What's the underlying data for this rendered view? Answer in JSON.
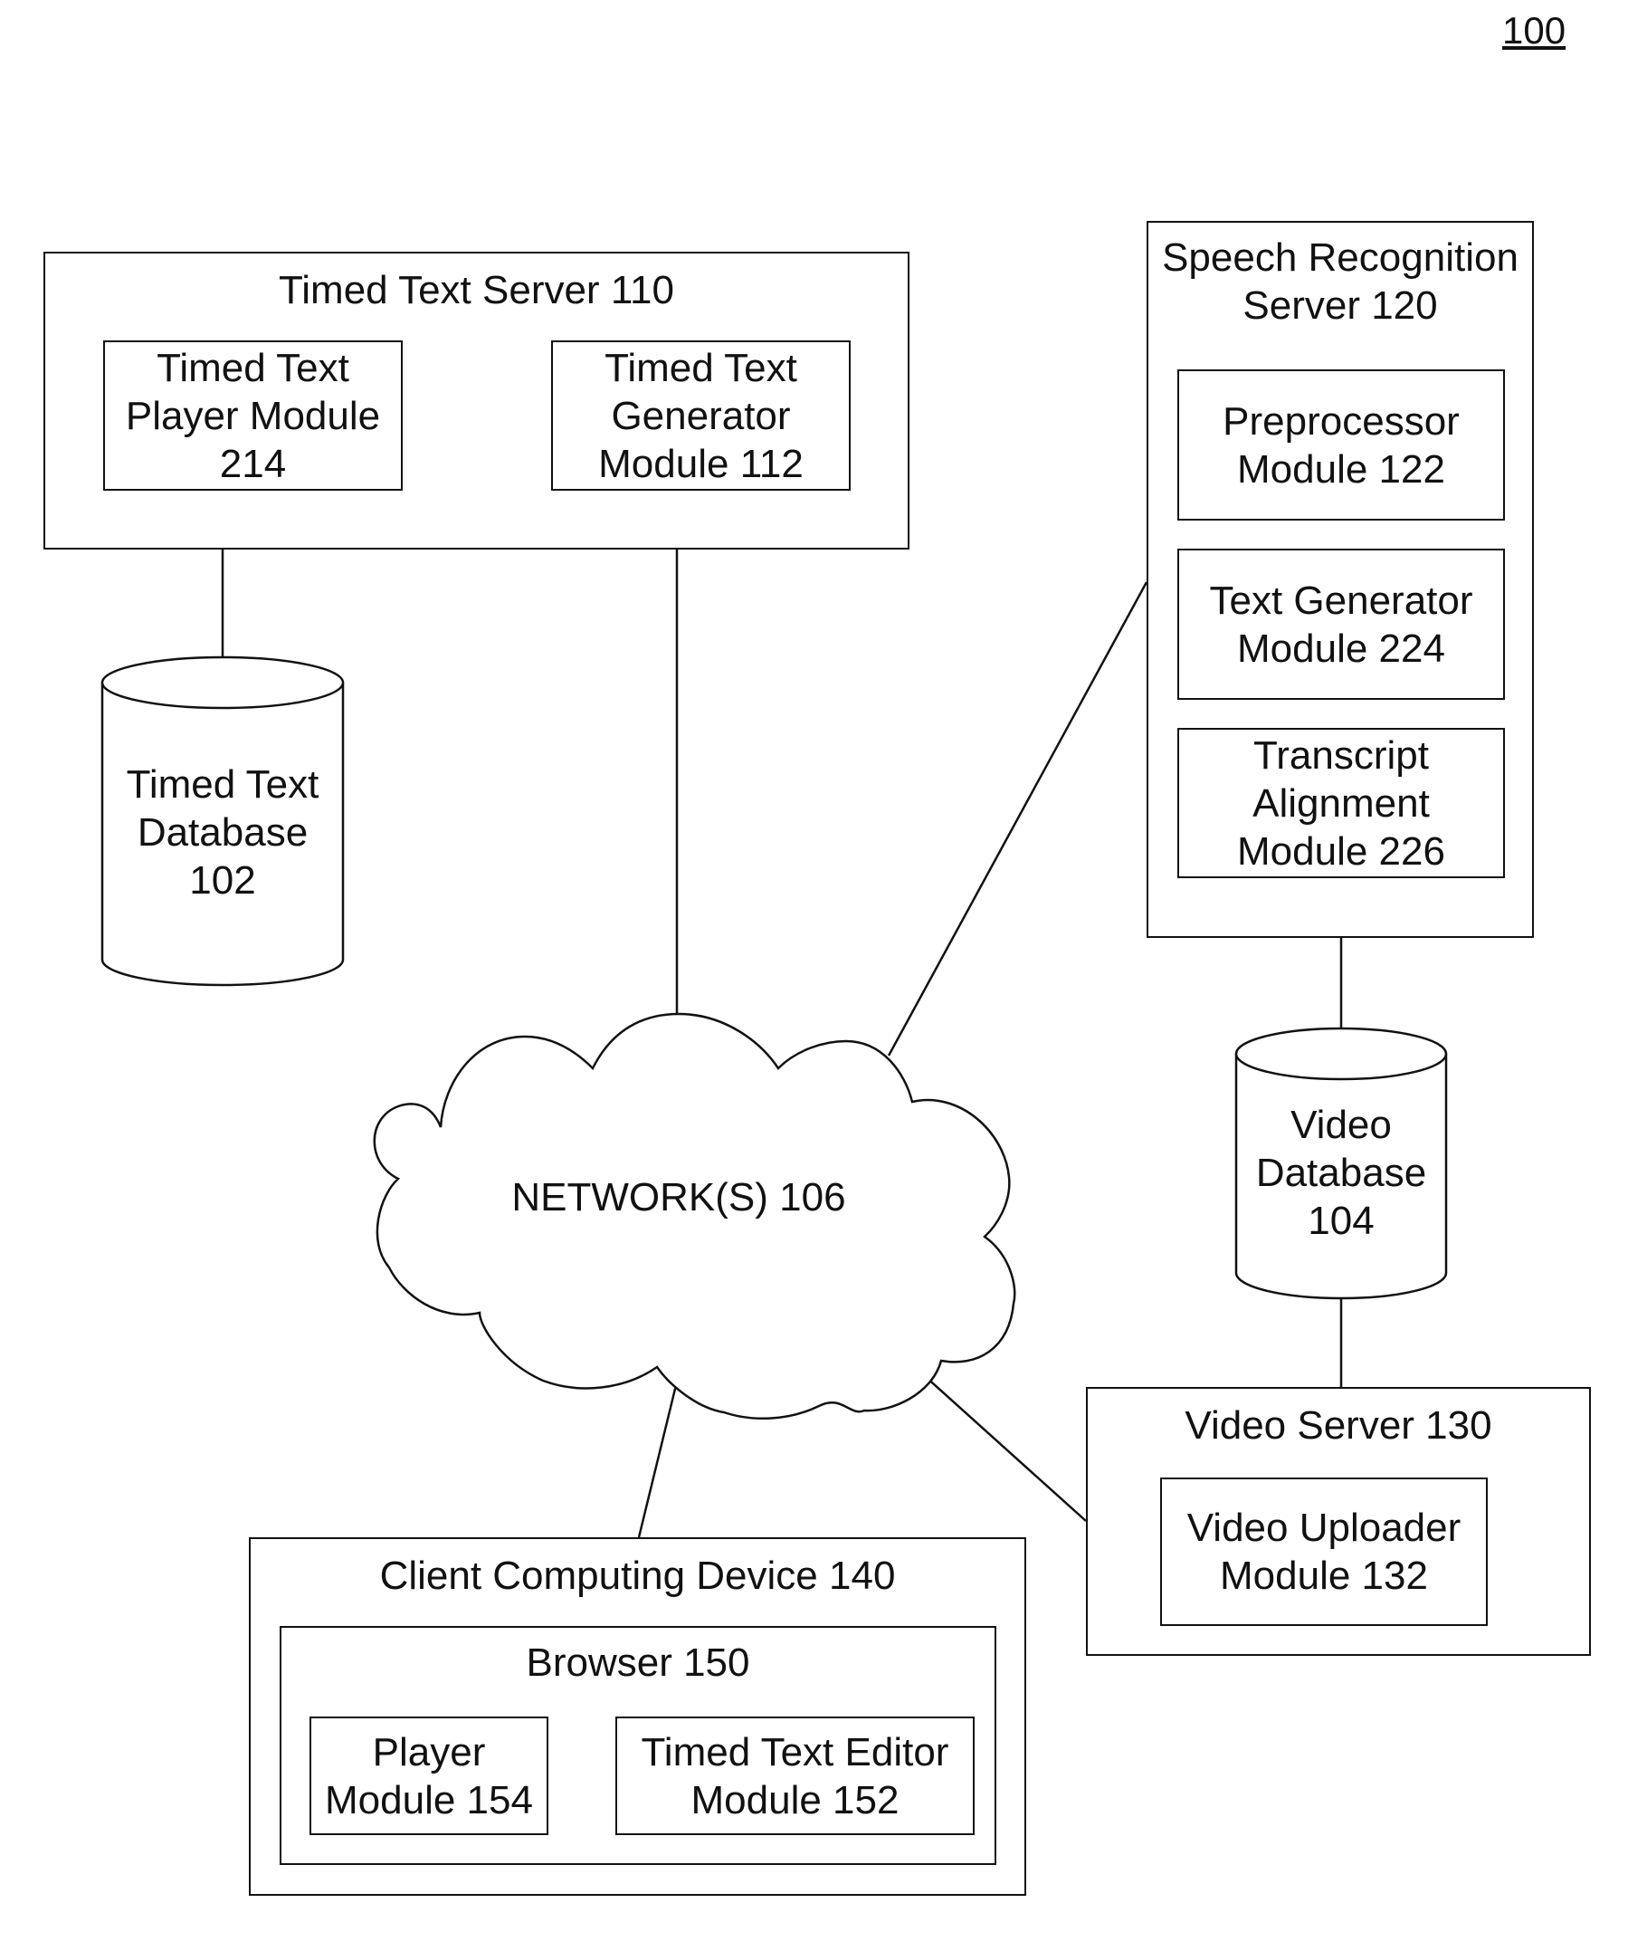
{
  "figure_number": "100",
  "network": {
    "label": "NETWORK(S) 106"
  },
  "timed_text_server": {
    "title": "Timed Text Server 110",
    "modules": [
      {
        "label": "Timed Text\nPlayer Module\n214"
      },
      {
        "label": "Timed Text\nGenerator\nModule 112"
      }
    ]
  },
  "timed_text_database": {
    "label": "Timed Text\nDatabase\n102"
  },
  "speech_recognition_server": {
    "title": "Speech Recognition\nServer 120",
    "modules": [
      {
        "label": "Preprocessor\nModule 122"
      },
      {
        "label": "Text Generator\nModule 224"
      },
      {
        "label": "Transcript\nAlignment\nModule 226"
      }
    ]
  },
  "video_database": {
    "label": "Video\nDatabase\n104"
  },
  "video_server": {
    "title": "Video Server 130",
    "modules": [
      {
        "label": "Video Uploader\nModule 132"
      }
    ]
  },
  "client_device": {
    "title": "Client Computing Device 140",
    "browser": {
      "title": "Browser 150",
      "modules": [
        {
          "label": "Player\nModule 154"
        },
        {
          "label": "Timed Text Editor\nModule 152"
        }
      ]
    }
  }
}
